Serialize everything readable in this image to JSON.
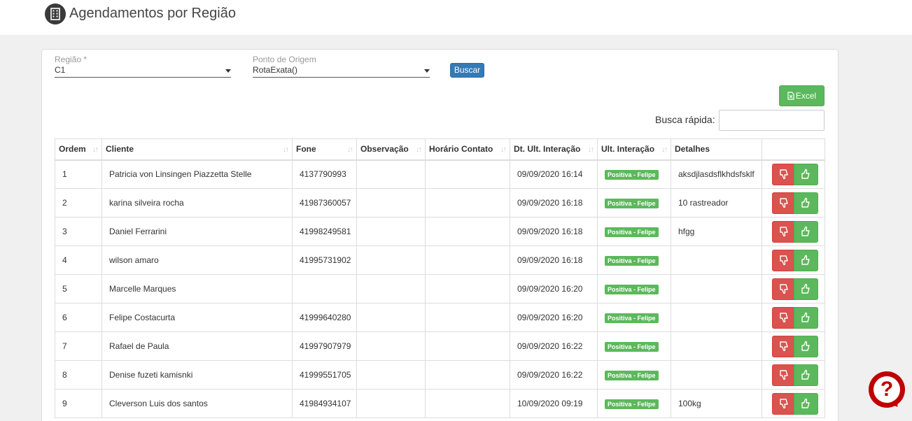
{
  "header": {
    "title": "Agendamentos por Região",
    "icon": "building-icon"
  },
  "filters": {
    "regiao": {
      "label": "Região *",
      "value": "C1"
    },
    "origem": {
      "label": "Ponto de Origem",
      "value": "RotaExata()"
    },
    "buscar_label": "Buscar"
  },
  "toolbar": {
    "excel_label": "Excel",
    "busca_label": "Busca rápida:",
    "busca_value": ""
  },
  "table": {
    "columns": [
      "Ordem",
      "Cliente",
      "Fone",
      "Observação",
      "Horário Contato",
      "Dt. Ult. Interação",
      "Ult. Interação",
      "Detalhes",
      ""
    ],
    "rows": [
      {
        "ordem": "1",
        "cliente": "Patricia von Linsingen Piazzetta Stelle",
        "fone": "4137790993",
        "obs": "",
        "horario": "",
        "dt": "09/09/2020 16:14",
        "ult": "Positiva - Felipe",
        "detalhes": "aksdjlasdsflkhdsfsklf"
      },
      {
        "ordem": "2",
        "cliente": "karina silveira rocha",
        "fone": "41987360057",
        "obs": "",
        "horario": "",
        "dt": "09/09/2020 16:18",
        "ult": "Positiva - Felipe",
        "detalhes": "10 rastreador"
      },
      {
        "ordem": "3",
        "cliente": "Daniel Ferrarini",
        "fone": "41998249581",
        "obs": "",
        "horario": "",
        "dt": "09/09/2020 16:18",
        "ult": "Positiva - Felipe",
        "detalhes": "hfgg"
      },
      {
        "ordem": "4",
        "cliente": "wilson amaro",
        "fone": "41995731902",
        "obs": "",
        "horario": "",
        "dt": "09/09/2020 16:18",
        "ult": "Positiva - Felipe",
        "detalhes": ""
      },
      {
        "ordem": "5",
        "cliente": "Marcelle Marques",
        "fone": "",
        "obs": "",
        "horario": "",
        "dt": "09/09/2020 16:20",
        "ult": "Positiva - Felipe",
        "detalhes": ""
      },
      {
        "ordem": "6",
        "cliente": "Felipe Costacurta",
        "fone": "41999640280",
        "obs": "",
        "horario": "",
        "dt": "09/09/2020 16:20",
        "ult": "Positiva - Felipe",
        "detalhes": ""
      },
      {
        "ordem": "7",
        "cliente": "Rafael de Paula",
        "fone": "41997907979",
        "obs": "",
        "horario": "",
        "dt": "09/09/2020 16:22",
        "ult": "Positiva - Felipe",
        "detalhes": ""
      },
      {
        "ordem": "8",
        "cliente": "Denise fuzeti kamisnki",
        "fone": "41999551705",
        "obs": "",
        "horario": "",
        "dt": "09/09/2020 16:22",
        "ult": "Positiva - Felipe",
        "detalhes": ""
      },
      {
        "ordem": "9",
        "cliente": "Cleverson Luis dos santos",
        "fone": "41984934107",
        "obs": "",
        "horario": "",
        "dt": "10/09/2020 09:19",
        "ult": "Positiva - Felipe",
        "detalhes": "100kg"
      }
    ]
  },
  "help": {
    "glyph": "?"
  },
  "colors": {
    "primary": "#337ab7",
    "success": "#5cb85c",
    "danger": "#d9534f",
    "help": "#c00000"
  }
}
